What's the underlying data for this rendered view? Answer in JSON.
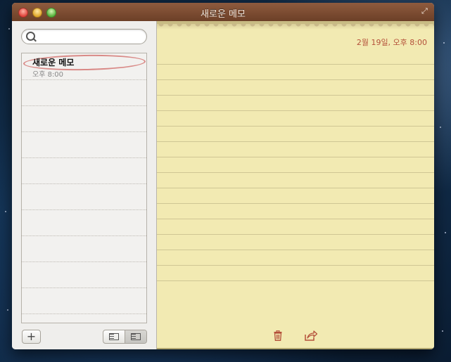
{
  "window": {
    "title": "새로운 메모"
  },
  "search": {
    "placeholder": "",
    "value": ""
  },
  "notes": [
    {
      "title": "새로운 메모",
      "time": "오후 8:00",
      "selected": true
    }
  ],
  "note_editor": {
    "date": "2월 19일, 오후 8:00",
    "body": ""
  },
  "toolbar": {
    "add_label": "+"
  },
  "icons": {
    "search": "search-icon",
    "trash": "trash-icon",
    "share": "share-icon",
    "fullscreen": "fullscreen-icon"
  },
  "colors": {
    "titlebar": "#7a4a31",
    "paper": "#f2eab2",
    "accent_red": "#b4503a",
    "selection_circle": "#d98a87"
  }
}
